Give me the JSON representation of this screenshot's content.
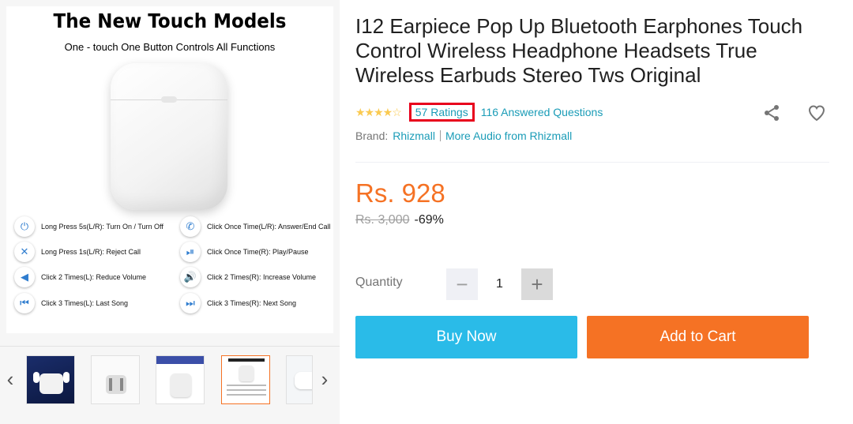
{
  "gallery": {
    "promo_title": "The New Touch Models",
    "promo_subtitle": "One - touch One Button Controls All Functions",
    "controls": [
      {
        "icon": "power-icon",
        "label": "Long  Press 5s(L/R): Turn On / Turn Off"
      },
      {
        "icon": "phone-answer-icon",
        "label": "Click Once Time(L/R): Answer/End Call"
      },
      {
        "icon": "phone-reject-icon",
        "label": "Long Press 1s(L/R): Reject Call"
      },
      {
        "icon": "play-pause-icon",
        "label": "Click Once Time(R): Play/Pause"
      },
      {
        "icon": "volume-down-icon",
        "label": "Click 2 Times(L): Reduce Volume"
      },
      {
        "icon": "volume-up-icon",
        "label": "Click 2 Times(R): Increase Volume"
      },
      {
        "icon": "previous-track-icon",
        "label": "Click 3 Times(L): Last Song"
      },
      {
        "icon": "next-track-icon",
        "label": "Click 3 Times(R): Next Song"
      }
    ],
    "thumbnails": [
      "thumb-1",
      "thumb-2",
      "thumb-3",
      "thumb-4",
      "thumb-5"
    ],
    "active_thumbnail": 3
  },
  "product": {
    "title": "I12 Earpiece Pop Up Bluetooth Earphones Touch Control Wireless Headphone Headsets True Wireless Earbuds Stereo Tws Original",
    "stars": "★★★★☆",
    "rating_value": 4.5,
    "ratings_label": "57 Ratings",
    "answered_label": "116 Answered Questions",
    "brand_label": "Brand:",
    "brand_name": "Rhizmall",
    "more_from": "More Audio from Rhizmall",
    "price": "Rs. 928",
    "original_price": "Rs. 3,000",
    "discount": "-69%",
    "quantity_label": "Quantity",
    "quantity": "1",
    "minus": "−",
    "plus": "+",
    "buy_now": "Buy Now",
    "add_to_cart": "Add to Cart"
  },
  "colors": {
    "accent_orange": "#f57224",
    "buy_blue": "#2abbe8",
    "link": "#1a9cb7",
    "highlight_box": "#e8001c"
  }
}
